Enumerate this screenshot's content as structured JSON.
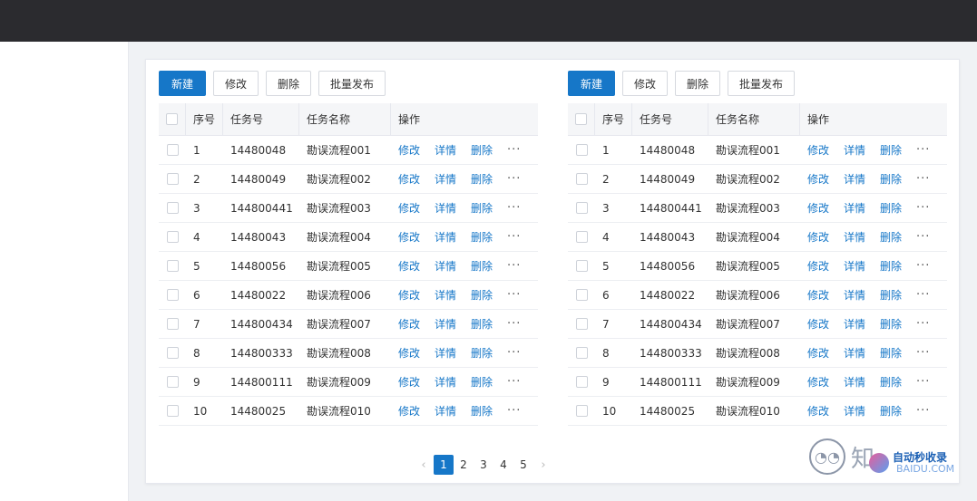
{
  "toolbar": {
    "new_label": "新建",
    "edit_label": "修改",
    "delete_label": "删除",
    "batch_publish_label": "批量发布"
  },
  "table": {
    "columns": [
      "序号",
      "任务号",
      "任务名称",
      "操作"
    ],
    "rows": [
      {
        "seq": "1",
        "task_no": "14480048",
        "task_name": "勘误流程001"
      },
      {
        "seq": "2",
        "task_no": "14480049",
        "task_name": "勘误流程002"
      },
      {
        "seq": "3",
        "task_no": "144800441",
        "task_name": "勘误流程003"
      },
      {
        "seq": "4",
        "task_no": "14480043",
        "task_name": "勘误流程004"
      },
      {
        "seq": "5",
        "task_no": "14480056",
        "task_name": "勘误流程005"
      },
      {
        "seq": "6",
        "task_no": "14480022",
        "task_name": "勘误流程006"
      },
      {
        "seq": "7",
        "task_no": "144800434",
        "task_name": "勘误流程007"
      },
      {
        "seq": "8",
        "task_no": "144800333",
        "task_name": "勘误流程008"
      },
      {
        "seq": "9",
        "task_no": "144800111",
        "task_name": "勘误流程009"
      },
      {
        "seq": "10",
        "task_no": "14480025",
        "task_name": "勘误流程010"
      }
    ],
    "row_actions": {
      "edit": "修改",
      "detail": "详情",
      "delete": "删除",
      "more": "···"
    }
  },
  "pagination": {
    "pages": [
      "1",
      "2",
      "3",
      "4",
      "5"
    ],
    "current": "1",
    "prev_icon": "‹",
    "next_icon": "›"
  },
  "watermark": {
    "zhihu_text": "知",
    "site_title": "自动秒收录",
    "site_domain": "BAIDU.COM"
  },
  "colors": {
    "primary": "#1677c8",
    "topbar": "#2b2b2f"
  }
}
